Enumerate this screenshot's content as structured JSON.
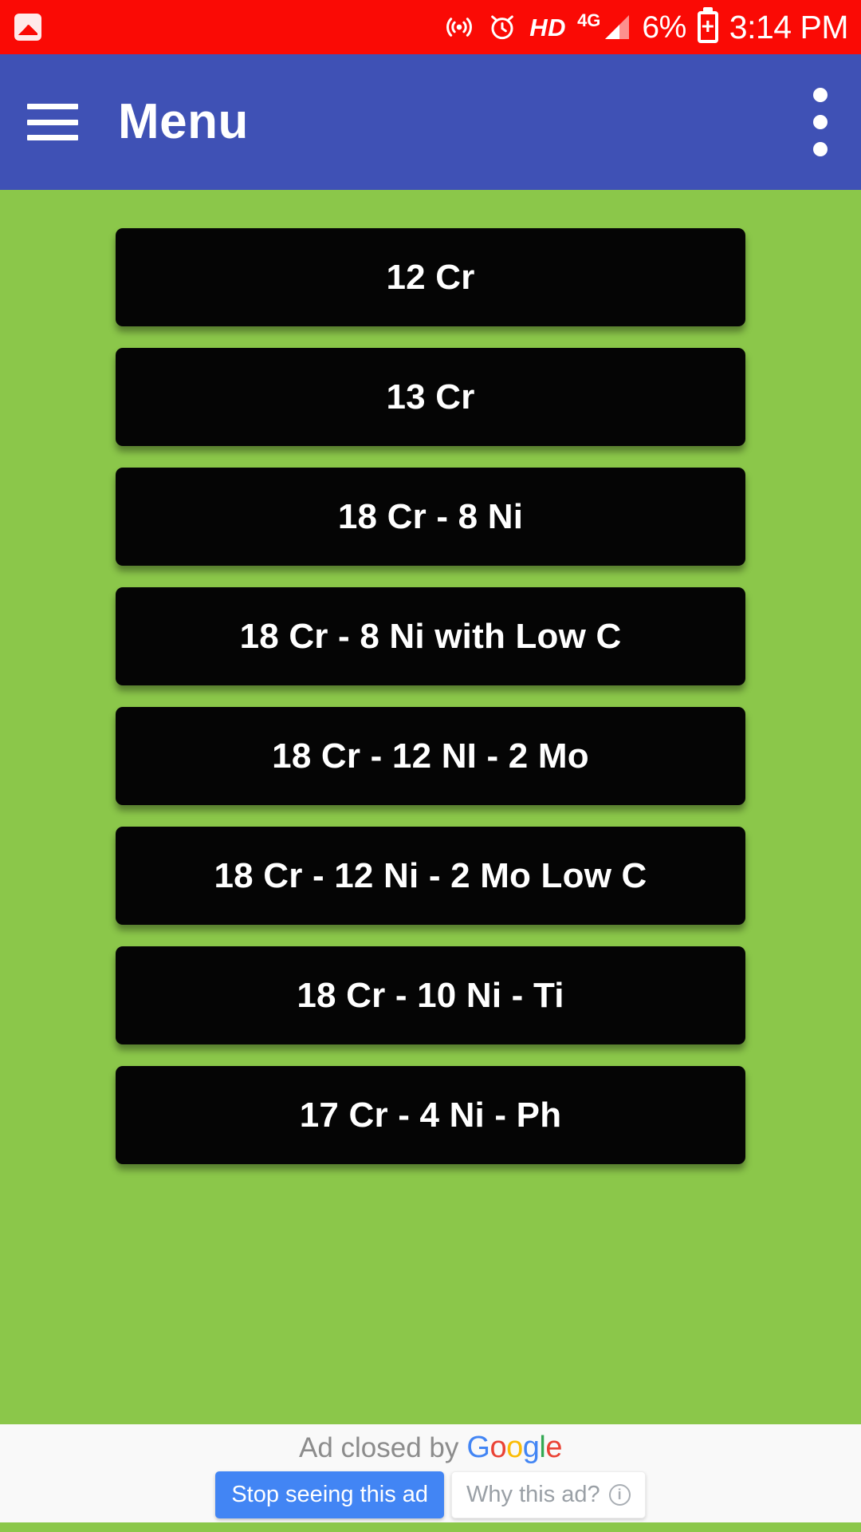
{
  "status_bar": {
    "background": "#FA0A05",
    "foreground": "#FFFFFF",
    "icons_left": [
      "photo-icon"
    ],
    "icons_right": [
      "hotspot-icon",
      "alarm-icon"
    ],
    "hd_label": "HD",
    "network_label": "4G",
    "battery_percent": "6%",
    "battery_state": "charging",
    "time": "3:14 PM"
  },
  "app_bar": {
    "background": "#3F51B5",
    "title": "Menu",
    "menu_icon": "hamburger-icon",
    "overflow_icon": "overflow-menu-icon"
  },
  "content": {
    "background": "#8BC74A",
    "button_background": "#050505",
    "button_text_color": "#FFFFFF",
    "buttons": [
      {
        "label": "12 Cr"
      },
      {
        "label": "13 Cr"
      },
      {
        "label": "18 Cr - 8 Ni"
      },
      {
        "label": "18 Cr - 8 Ni with Low C"
      },
      {
        "label": "18 Cr - 12 NI - 2 Mo"
      },
      {
        "label": "18 Cr - 12 Ni - 2 Mo Low C"
      },
      {
        "label": "18 Cr - 10 Ni - Ti"
      },
      {
        "label": "17 Cr - 4 Ni - Ph"
      }
    ]
  },
  "ad_banner": {
    "background": "#F9F9F9",
    "closed_text": "Ad closed by",
    "brand": "Google",
    "brand_letters": [
      "G",
      "o",
      "o",
      "g",
      "l",
      "e"
    ],
    "stop_button_label": "Stop seeing this ad",
    "stop_button_color": "#4285F4",
    "why_button_label": "Why this ad?",
    "why_button_icon": "info-icon"
  }
}
